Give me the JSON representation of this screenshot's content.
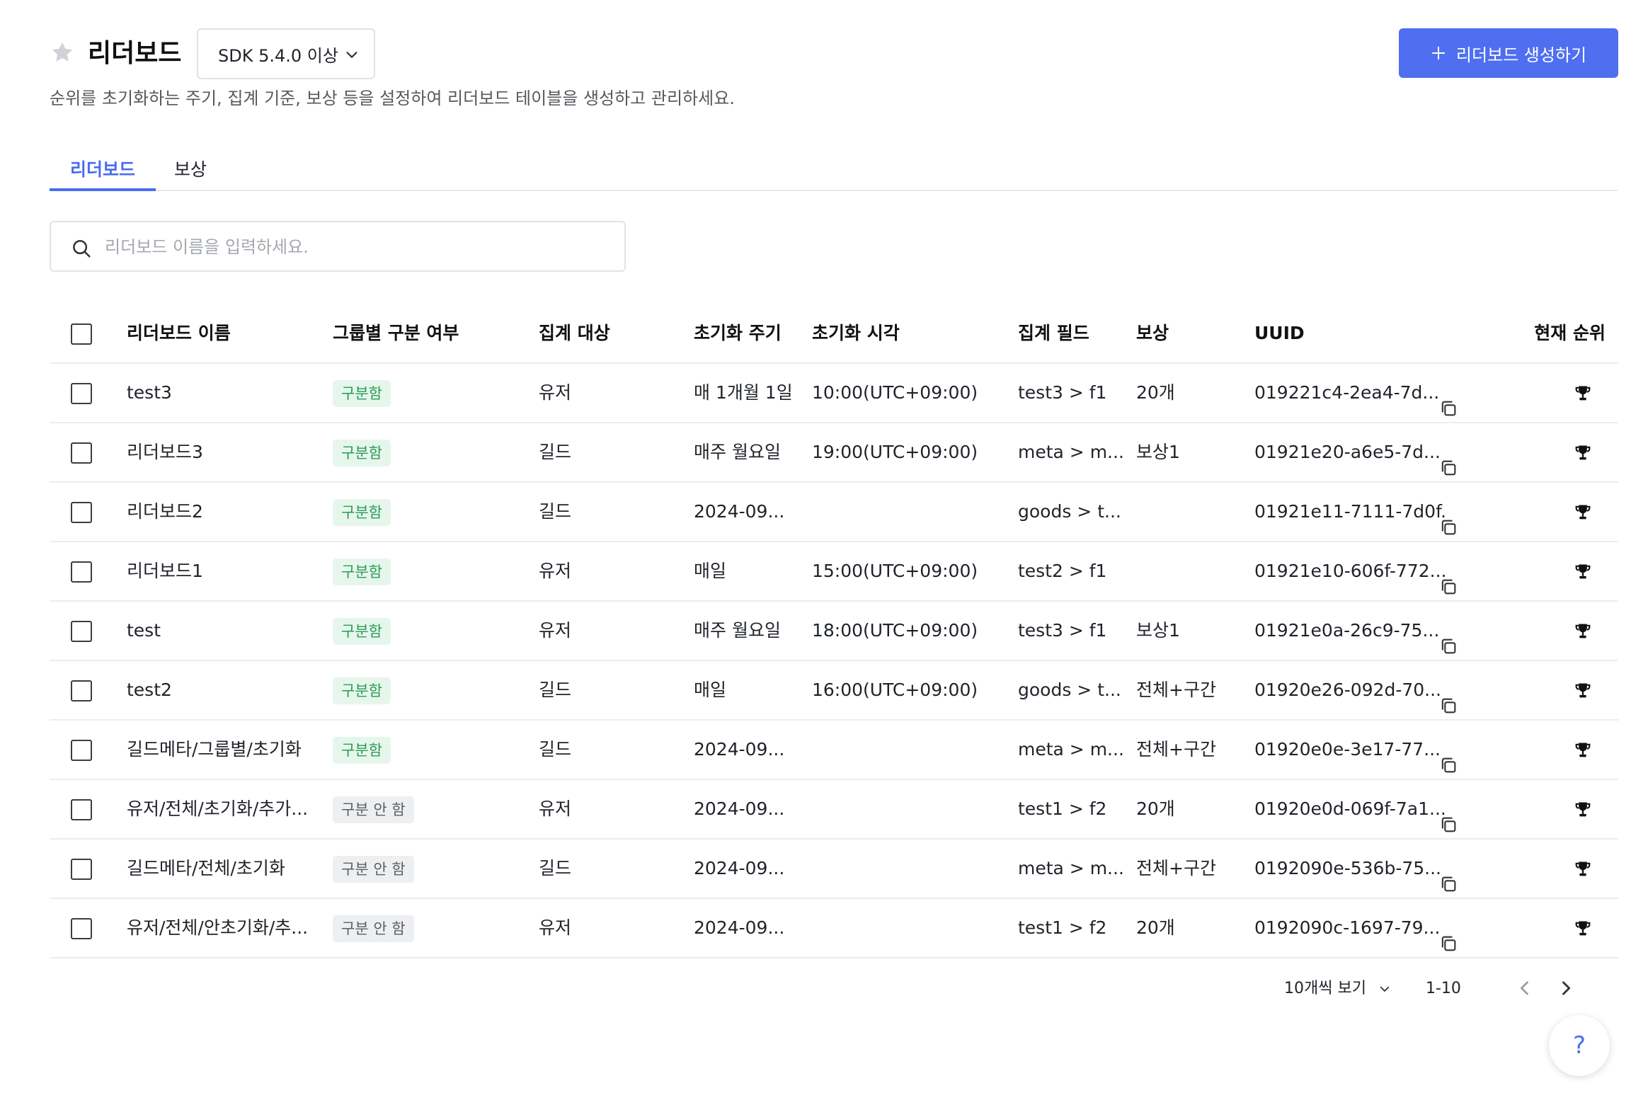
{
  "header": {
    "title": "리더보드",
    "sdk_selected": "SDK 5.4.0 이상",
    "create_label": "리더보드 생성하기",
    "subtitle": "순위를 초기화하는 주기, 집계 기준, 보상 등을 설정하여 리더보드 테이블을 생성하고 관리하세요."
  },
  "tabs": [
    {
      "label": "리더보드",
      "active": true
    },
    {
      "label": "보상",
      "active": false
    }
  ],
  "search": {
    "placeholder": "리더보드 이름을 입력하세요.",
    "value": ""
  },
  "table": {
    "headers": {
      "name": "리더보드 이름",
      "group": "그룹별 구분 여부",
      "target": "집계 대상",
      "period": "초기화 주기",
      "time": "초기화 시각",
      "field": "집계 필드",
      "reward": "보상",
      "uuid": "UUID",
      "rank": "현재 순위"
    },
    "rows": [
      {
        "name": "test3",
        "group": "구분함",
        "group_on": true,
        "target": "유저",
        "period": "매 1개월 1일",
        "time": "10:00(UTC+09:00)",
        "field": "test3 > f1",
        "reward": "20개",
        "uuid": "019221c4-2ea4-7d..."
      },
      {
        "name": "리더보드3",
        "group": "구분함",
        "group_on": true,
        "target": "길드",
        "period": "매주 월요일",
        "time": "19:00(UTC+09:00)",
        "field": "meta > m...",
        "reward": "보상1",
        "uuid": "01921e20-a6e5-7d..."
      },
      {
        "name": "리더보드2",
        "group": "구분함",
        "group_on": true,
        "target": "길드",
        "period": "2024-09...",
        "time": "",
        "field": "goods > t...",
        "reward": "",
        "uuid": "01921e11-7111-7d0f..."
      },
      {
        "name": "리더보드1",
        "group": "구분함",
        "group_on": true,
        "target": "유저",
        "period": "매일",
        "time": "15:00(UTC+09:00)",
        "field": "test2 > f1",
        "reward": "",
        "uuid": "01921e10-606f-772..."
      },
      {
        "name": "test",
        "group": "구분함",
        "group_on": true,
        "target": "유저",
        "period": "매주 월요일",
        "time": "18:00(UTC+09:00)",
        "field": "test3 > f1",
        "reward": "보상1",
        "uuid": "01921e0a-26c9-75..."
      },
      {
        "name": "test2",
        "group": "구분함",
        "group_on": true,
        "target": "길드",
        "period": "매일",
        "time": "16:00(UTC+09:00)",
        "field": "goods > t...",
        "reward": "전체+구간",
        "uuid": "01920e26-092d-70..."
      },
      {
        "name": "길드메타/그룹별/초기화",
        "group": "구분함",
        "group_on": true,
        "target": "길드",
        "period": "2024-09...",
        "time": "",
        "field": "meta > m...",
        "reward": "전체+구간",
        "uuid": "01920e0e-3e17-77..."
      },
      {
        "name": "유저/전체/초기화/추가...",
        "group": "구분 안 함",
        "group_on": false,
        "target": "유저",
        "period": "2024-09...",
        "time": "",
        "field": "test1 > f2",
        "reward": "20개",
        "uuid": "01920e0d-069f-7a1..."
      },
      {
        "name": "길드메타/전체/초기화",
        "group": "구분 안 함",
        "group_on": false,
        "target": "길드",
        "period": "2024-09...",
        "time": "",
        "field": "meta > m...",
        "reward": "전체+구간",
        "uuid": "0192090e-536b-75..."
      },
      {
        "name": "유저/전체/안초기화/추...",
        "group": "구분 안 함",
        "group_on": false,
        "target": "유저",
        "period": "2024-09...",
        "time": "",
        "field": "test1 > f2",
        "reward": "20개",
        "uuid": "0192090c-1697-79..."
      }
    ]
  },
  "pagination": {
    "per_page": "10개씩 보기",
    "range": "1-10"
  },
  "help": {
    "label": "?"
  },
  "colors": {
    "accent": "#4f6ff0",
    "badge_on_bg": "#e7f6ec",
    "badge_on_text": "#2a9c55",
    "badge_off_bg": "#eeeff1"
  }
}
